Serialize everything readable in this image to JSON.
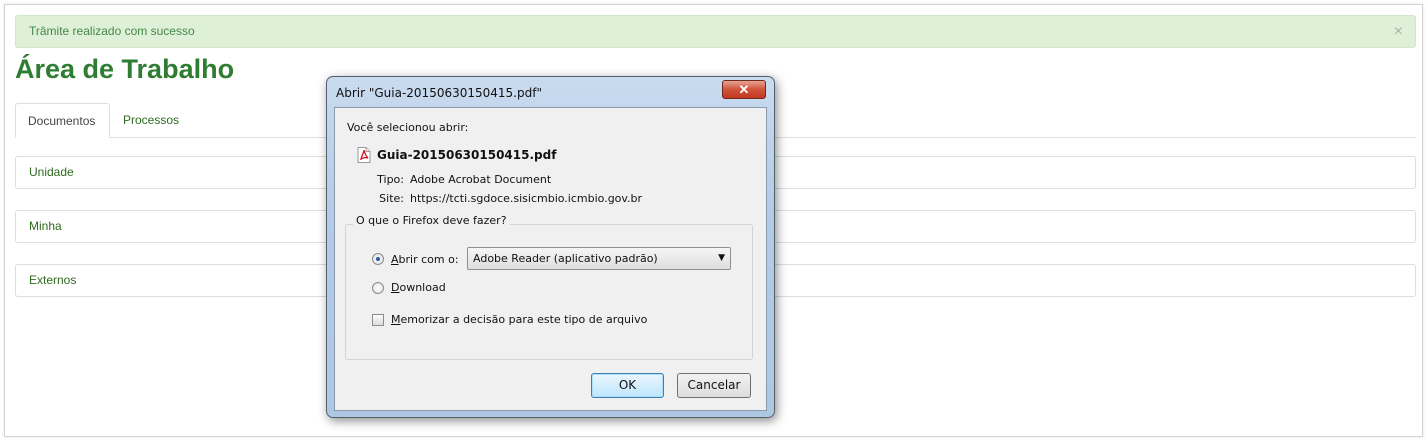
{
  "alert": {
    "message": "Trâmite realizado com sucesso",
    "close": "×"
  },
  "page": {
    "title": "Área de Trabalho"
  },
  "tabs": [
    {
      "label": "Documentos",
      "active": true
    },
    {
      "label": "Processos",
      "active": false
    }
  ],
  "panels": [
    {
      "label": "Unidade"
    },
    {
      "label": "Minha"
    },
    {
      "label": "Externos"
    }
  ],
  "dialog": {
    "title": "Abrir \"Guia-20150630150415.pdf\"",
    "close": "✕",
    "you_selected": "Você selecionou abrir:",
    "file_name": "Guia-20150630150415.pdf",
    "type_label": "Tipo:",
    "type_value": "Adobe Acrobat Document",
    "site_label": "Site:",
    "site_value": "https://tcti.sgdoce.sisicmbio.icmbio.gov.br",
    "question": "O que o Firefox deve fazer?",
    "open_with_prefix": "A",
    "open_with_rest": "brir com o:",
    "open_with_selected": "Adobe Reader  (aplicativo padrão)",
    "download_prefix": "D",
    "download_rest": "ownload",
    "remember_prefix": "M",
    "remember_rest": "emorizar a decisão para este tipo de arquivo",
    "ok": "OK",
    "cancel": "Cancelar",
    "selected_action": "open",
    "remember_checked": false
  },
  "colors": {
    "title_green": "#2e7d32",
    "link_green": "#2e6b1f",
    "alert_bg": "#dff0d8",
    "alert_text": "#468847"
  }
}
